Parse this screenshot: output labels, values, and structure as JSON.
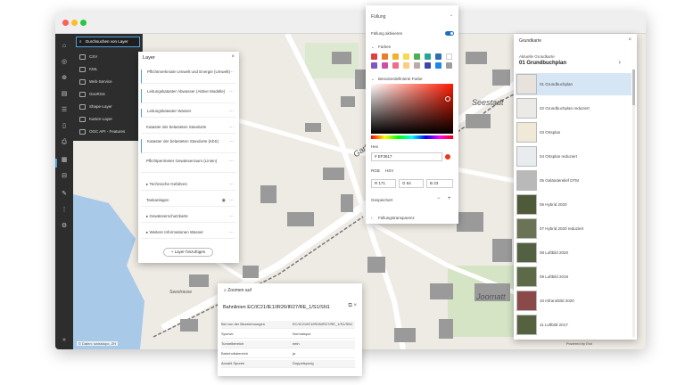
{
  "app": {
    "window_dots": [
      "#ff5f57",
      "#febc2e",
      "#28c840"
    ],
    "accent": "#1e6fb8"
  },
  "iconbar": {
    "icons": [
      "home-icon",
      "globe-icon",
      "add-data-icon",
      "layers-icon",
      "legend-icon",
      "bookmark-icon",
      "print-icon",
      "table-icon",
      "measure-icon",
      "draw-icon",
      "share-icon",
      "tools-icon",
      "expand-icon"
    ]
  },
  "datapanel": {
    "search_label": "Durchsuchen von Layer",
    "items": [
      {
        "label": "CSV",
        "icon": "csv-icon"
      },
      {
        "label": "KML",
        "icon": "kml-icon"
      },
      {
        "label": "Web-Service",
        "icon": "webservice-icon"
      },
      {
        "label": "GeoRSS",
        "icon": "georss-icon"
      },
      {
        "label": "Shape-Layer",
        "icon": "shape-icon"
      },
      {
        "label": "Karten-Layer",
        "icon": "map-layer-icon"
      },
      {
        "label": "OGC API - Features",
        "icon": "ogc-icon"
      }
    ]
  },
  "layerpanel": {
    "title": "Layer",
    "items": [
      "Pflichtmerkmale Umwelt und Energie (Umwelt)",
      "Leitungskataster Abwasser (Aktive Modelle)",
      "Leitungskataster Wasser",
      "Kataster der belasteten Standorte",
      "Kataster der belasteten Standorte (KbS)",
      "Pflichtperimeter Gewässerraum (Linien)",
      "Technische Gefahren",
      "Tankanlagen",
      "Gewässerschutzkarte",
      "Weitere Informationen Wasser"
    ],
    "add_button": "+ Layer hinzufügen"
  },
  "colorpanel": {
    "title": "Füllung",
    "toggle_label": "Füllung aktivieren",
    "swatches_label": "Farben",
    "swatches": [
      "#e04040",
      "#e87d2b",
      "#f0b429",
      "#f7d94c",
      "#4caf50",
      "#26a69a",
      "#2d6fb5",
      "#ffffff",
      "#7e57c2",
      "#d04fa5",
      "#ef6c8c",
      "#ffcc80",
      "#bcaaa4",
      "#3949ab",
      "#1e88e5",
      "#9e9e9e"
    ],
    "custom_label": "Benutzerdefinierte Farbe",
    "hex_label": "Hex",
    "hex_value": "# EF3617",
    "rgb_label": "RGB",
    "rgb_mode": "HSV",
    "r": "R  171",
    "g": "G  54",
    "b": "B  23",
    "saved_label": "Gespeichert",
    "transparency_label": "Füllungstransparenz",
    "current_color": "#ef3617"
  },
  "basemap": {
    "title": "Grundkarte",
    "subtitle": "Aktuelle Grundkarte",
    "current": "01 Grundbuchplan",
    "items": [
      {
        "label": "01 Grundbuchplan",
        "thumb": "#e7e3dc"
      },
      {
        "label": "02 Grundbuchplan reduziert",
        "thumb": "#eceae6"
      },
      {
        "label": "03 Ortsplan",
        "thumb": "#f1e9d8"
      },
      {
        "label": "04 Ortsplan reduziert",
        "thumb": "#e9ecef"
      },
      {
        "label": "05 Geländerelief DTM",
        "thumb": "#b9b9b9"
      },
      {
        "label": "06 Hybrid 2020",
        "thumb": "#4f5a3a"
      },
      {
        "label": "07 Hybrid 2020 reduziert",
        "thumb": "#6a7355"
      },
      {
        "label": "08 Luftbild 2020",
        "thumb": "#536041"
      },
      {
        "label": "09 Luftbild 2019",
        "thumb": "#5d6a47"
      },
      {
        "label": "10 Infrarotbild 2020",
        "thumb": "#8a4a4a"
      },
      {
        "label": "11 Luftbild 2017",
        "thumb": "#56623f"
      }
    ]
  },
  "popup": {
    "zoom_label": "Zoomen auf",
    "title": "Bahnlinien EC/IC21/IE1/IR26/IR27/RE_1/S1/SN1",
    "rows": [
      {
        "k": "Bei von der Bezeichnungen",
        "v": "EC/IC21/IE1/IR26/IR27/RE_1/S1/SN1"
      },
      {
        "k": "Spurwe",
        "v": "Normalspur"
      },
      {
        "k": "Tunnelbereich",
        "v": "nein"
      },
      {
        "k": "Bahnhofsbereich",
        "v": "ja"
      },
      {
        "k": "Anzahl Spuren",
        "v": "Doppelspurig"
      }
    ]
  },
  "map": {
    "labels": [
      "Gartenstrasse",
      "Seestadt",
      "Joornatt",
      "Seestrasse"
    ],
    "attribution": "© Daten: swisstopo, ZH",
    "powered_by": "Powered by Esri",
    "water_color": "#a9c9e8",
    "road_color": "#ffffff",
    "building_color": "#9a9a9a"
  }
}
